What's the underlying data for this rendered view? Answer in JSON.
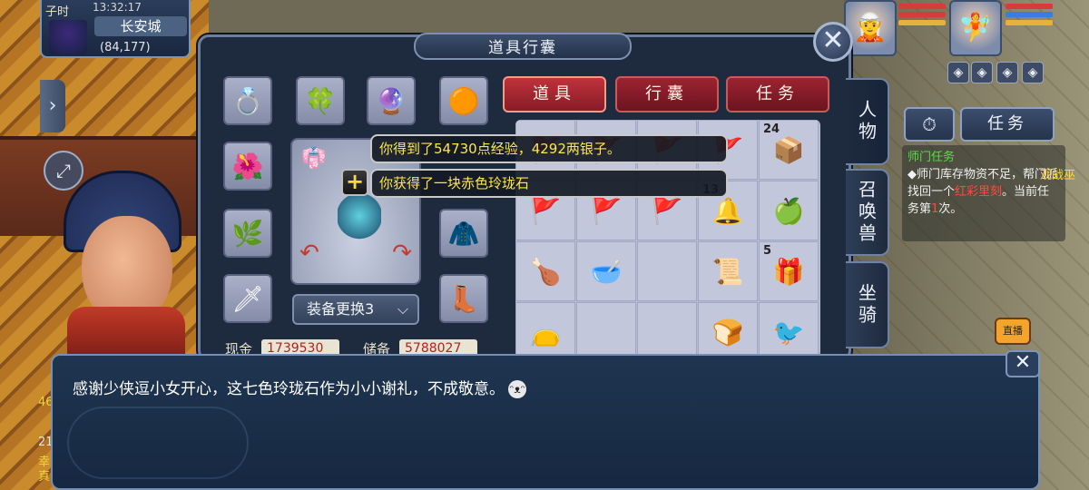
{
  "location": {
    "clock_label": "子时",
    "time": "13:32:17",
    "city": "长安城",
    "coords": "(84,177)"
  },
  "panel": {
    "title": "道具行囊",
    "swap_label": "装备更换3",
    "cash_label": "现金",
    "cash_value": "1739530",
    "reserve_label": "储备",
    "reserve_value": "5788027",
    "tabs": [
      "道具",
      "行囊",
      "任务"
    ],
    "side_tabs": [
      "人物",
      "召唤兽",
      "坐骑"
    ]
  },
  "equipment": {
    "slots": [
      {
        "name": "helmet",
        "icon": "helmet-icon",
        "glyph": "💍"
      },
      {
        "name": "necklace",
        "icon": "jade-icon",
        "glyph": "🍀"
      },
      {
        "name": "pendant",
        "icon": "pendant-icon",
        "glyph": "🔮"
      },
      {
        "name": "ring",
        "icon": "ring-icon",
        "glyph": "🟠"
      },
      {
        "name": "weapon",
        "icon": "flower-weapon-icon",
        "glyph": "🌺"
      },
      {
        "name": "staff",
        "icon": "staff-icon",
        "glyph": "🌿"
      },
      {
        "name": "sword",
        "icon": "sword-icon",
        "glyph": "🗡"
      },
      {
        "name": "armor",
        "icon": "armor-icon",
        "glyph": "🧥"
      },
      {
        "name": "boots",
        "icon": "boots-icon",
        "glyph": "👢"
      }
    ]
  },
  "inventory": {
    "cells": [
      {
        "icon": "flag-icon",
        "glyph": "🚩",
        "count": ""
      },
      {
        "icon": "flag-icon",
        "glyph": "🚩",
        "count": ""
      },
      {
        "icon": "flag-icon",
        "glyph": "🚩",
        "count": ""
      },
      {
        "icon": "flag-icon",
        "glyph": "🚩",
        "count": ""
      },
      {
        "icon": "box-icon",
        "glyph": "📦",
        "count": "24"
      },
      {
        "icon": "flag-icon",
        "glyph": "🚩",
        "count": ""
      },
      {
        "icon": "flag-icon",
        "glyph": "🚩",
        "count": ""
      },
      {
        "icon": "flag-icon",
        "glyph": "🚩",
        "count": ""
      },
      {
        "icon": "bell-icon",
        "glyph": "🔔",
        "count": "13"
      },
      {
        "icon": "fruit-basket-icon",
        "glyph": "🍏",
        "count": ""
      },
      {
        "icon": "chicken-leg-icon",
        "glyph": "🍗",
        "count": ""
      },
      {
        "icon": "bowl-icon",
        "glyph": "🥣",
        "count": ""
      },
      {
        "icon": "empty",
        "glyph": "",
        "count": ""
      },
      {
        "icon": "scroll-icon",
        "glyph": "📜",
        "count": ""
      },
      {
        "icon": "gift-box-icon",
        "glyph": "🎁",
        "count": "5"
      },
      {
        "icon": "bag-icon",
        "glyph": "👝",
        "count": ""
      },
      {
        "icon": "empty",
        "glyph": "",
        "count": ""
      },
      {
        "icon": "empty",
        "glyph": "",
        "count": ""
      },
      {
        "icon": "bread-icon",
        "glyph": "🍞",
        "count": ""
      },
      {
        "icon": "bird-icon",
        "glyph": "🐦",
        "count": ""
      }
    ]
  },
  "notifications": {
    "exp_message": "你得到了54730点经验，4292两银子。",
    "item_message": "你获得了一块赤色玲珑石"
  },
  "quest": {
    "tab_label": "任务",
    "title": "师门任务",
    "line1": "◆师门库存物资不足，帮门派找回一个",
    "line1_red": "红",
    "line2_red": "彩里刻",
    "line3": "。当前任务第",
    "line3_red": "1",
    "line4": "次。",
    "side_label": "观战巫",
    "live_label": "直播"
  },
  "left_hud": {
    "number1": "46",
    "number2": "21",
    "text1": "幸",
    "text2": "真"
  },
  "dialog": {
    "message": "感谢少侠逗小女开心，这七色玲珑石作为小小谢礼，不成敬意。"
  },
  "colors": {
    "accent_red": "#9c2430",
    "notice_yellow": "#ffe64b",
    "quest_green": "#55e03e"
  }
}
